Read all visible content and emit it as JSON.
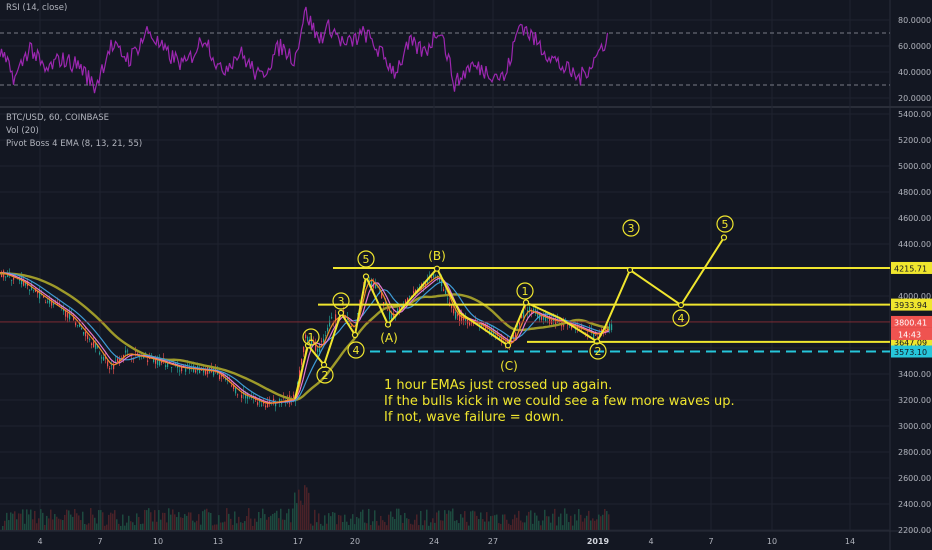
{
  "rsi_panel": {
    "label": "RSI (14, close)",
    "line_color": "#9c27b0",
    "ticks": [
      "80.0000",
      "60.0000",
      "40.0000",
      "20.0000"
    ],
    "tick_values": [
      80,
      60,
      40,
      20
    ],
    "band_upper": 70,
    "band_lower": 30
  },
  "price_panel": {
    "symbol_line": "BTC/USD, 60, COINBASE",
    "vol_line": "Vol (20)",
    "ema_line": "Pivot Boss 4 EMA (8, 13, 21, 55)"
  },
  "chart_data": {
    "type": "line",
    "x_ticks": [
      "4",
      "7",
      "10",
      "13",
      "17",
      "20",
      "24",
      "27",
      "2019",
      "4",
      "7",
      "10",
      "14"
    ],
    "y_ticks": [
      5400,
      5200,
      5000,
      4800,
      4600,
      4400,
      4000,
      3600,
      3400,
      3200,
      3000,
      2800,
      2600,
      2400,
      2200
    ],
    "ylim": [
      2200,
      5480
    ],
    "price_labels": [
      {
        "value": 4215.71,
        "text": "4215.71",
        "color": "#f0e62e"
      },
      {
        "value": 3933.94,
        "text": "3933.94",
        "color": "#f0e62e"
      },
      {
        "value": 3800.41,
        "text": "3800.41",
        "color": "#ef5350"
      },
      {
        "value": 3647.09,
        "text": "3647.09",
        "color": "#f0e62e"
      },
      {
        "value": 3573.1,
        "text": "3573.10",
        "color": "#26c6da"
      }
    ],
    "countdown": "14:43",
    "support_lines": [
      4215.71,
      3933.94,
      3647.09
    ],
    "dashed_support": 3573.1,
    "wave_labels": [
      "1",
      "2",
      "3",
      "4",
      "5",
      "(A)",
      "(B)",
      "(C)",
      "1",
      "2",
      "3",
      "4",
      "5"
    ],
    "colors": {
      "annotation": "#f0e62e",
      "dashed": "#26c6da",
      "last_price": "#ef5350"
    }
  },
  "annotation": {
    "line1": "1 hour EMAs just crossed up again.",
    "line2": "If the bulls kick in we could see a few more waves up.",
    "line3": "If not, wave failure = down."
  }
}
